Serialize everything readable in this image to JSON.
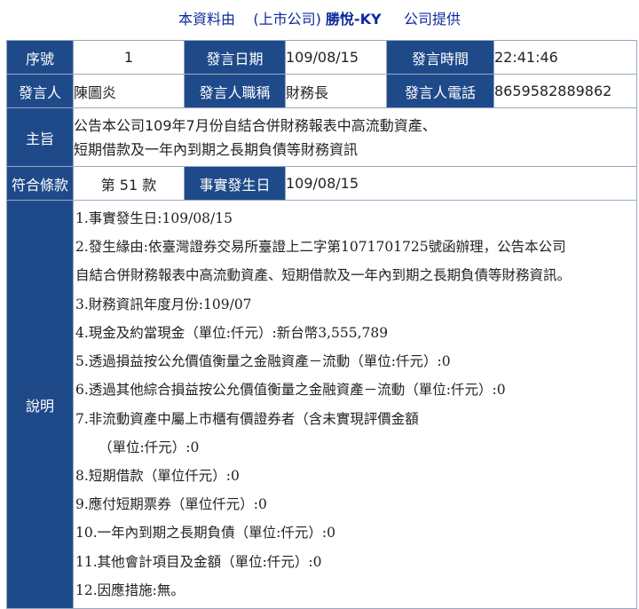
{
  "header": {
    "prefix": "本資料由",
    "company_type": "(上市公司)",
    "company_name": "勝悅-KY",
    "suffix": "公司提供"
  },
  "row1": {
    "seq_label": "序號",
    "seq_value": "1",
    "date_label": "發言日期",
    "date_value": "109/08/15",
    "time_label": "發言時間",
    "time_value": "22:41:46"
  },
  "row2": {
    "speaker_label": "發言人",
    "speaker_value": "陳圖炎",
    "title_label": "發言人職稱",
    "title_value": "財務長",
    "phone_label": "發言人電話",
    "phone_value": "8659582889862"
  },
  "subject": {
    "label": "主旨",
    "lines": [
      "公告本公司109年7月份自結合併財務報表中高流動資產、",
      "短期借款及一年內到期之長期負債等財務資訊"
    ]
  },
  "row4": {
    "clause_label": "符合條款",
    "clause_value": "第 51 款",
    "event_label": "事實發生日",
    "event_value": "109/08/15"
  },
  "description": {
    "label": "說明",
    "lines": [
      "1.事實發生日:109/08/15",
      "2.發生緣由:依臺灣證券交易所臺證上二字第1071701725號函辦理，公告本公司",
      "自結合併財務報表中高流動資產、短期借款及一年內到期之長期負債等財務資訊。",
      "3.財務資訊年度月份:109/07",
      "4.現金及約當現金（單位:仟元）:新台幣3,555,789",
      "5.透過損益按公允價值衡量之金融資產－流動（單位:仟元）:0",
      "6.透過其他綜合損益按公允價值衡量之金融資產－流動（單位:仟元）:0",
      "7.非流動資產中屬上市櫃有價證券者（含未實現評價金額",
      "（單位:仟元）:0",
      "8.短期借款（單位仟元）:0",
      "9.應付短期票券（單位仟元）:0",
      "10.一年內到期之長期負債（單位:仟元）:0",
      "11.其他會計項目及金額（單位:仟元）:0",
      "12.因應措施:無。"
    ]
  }
}
